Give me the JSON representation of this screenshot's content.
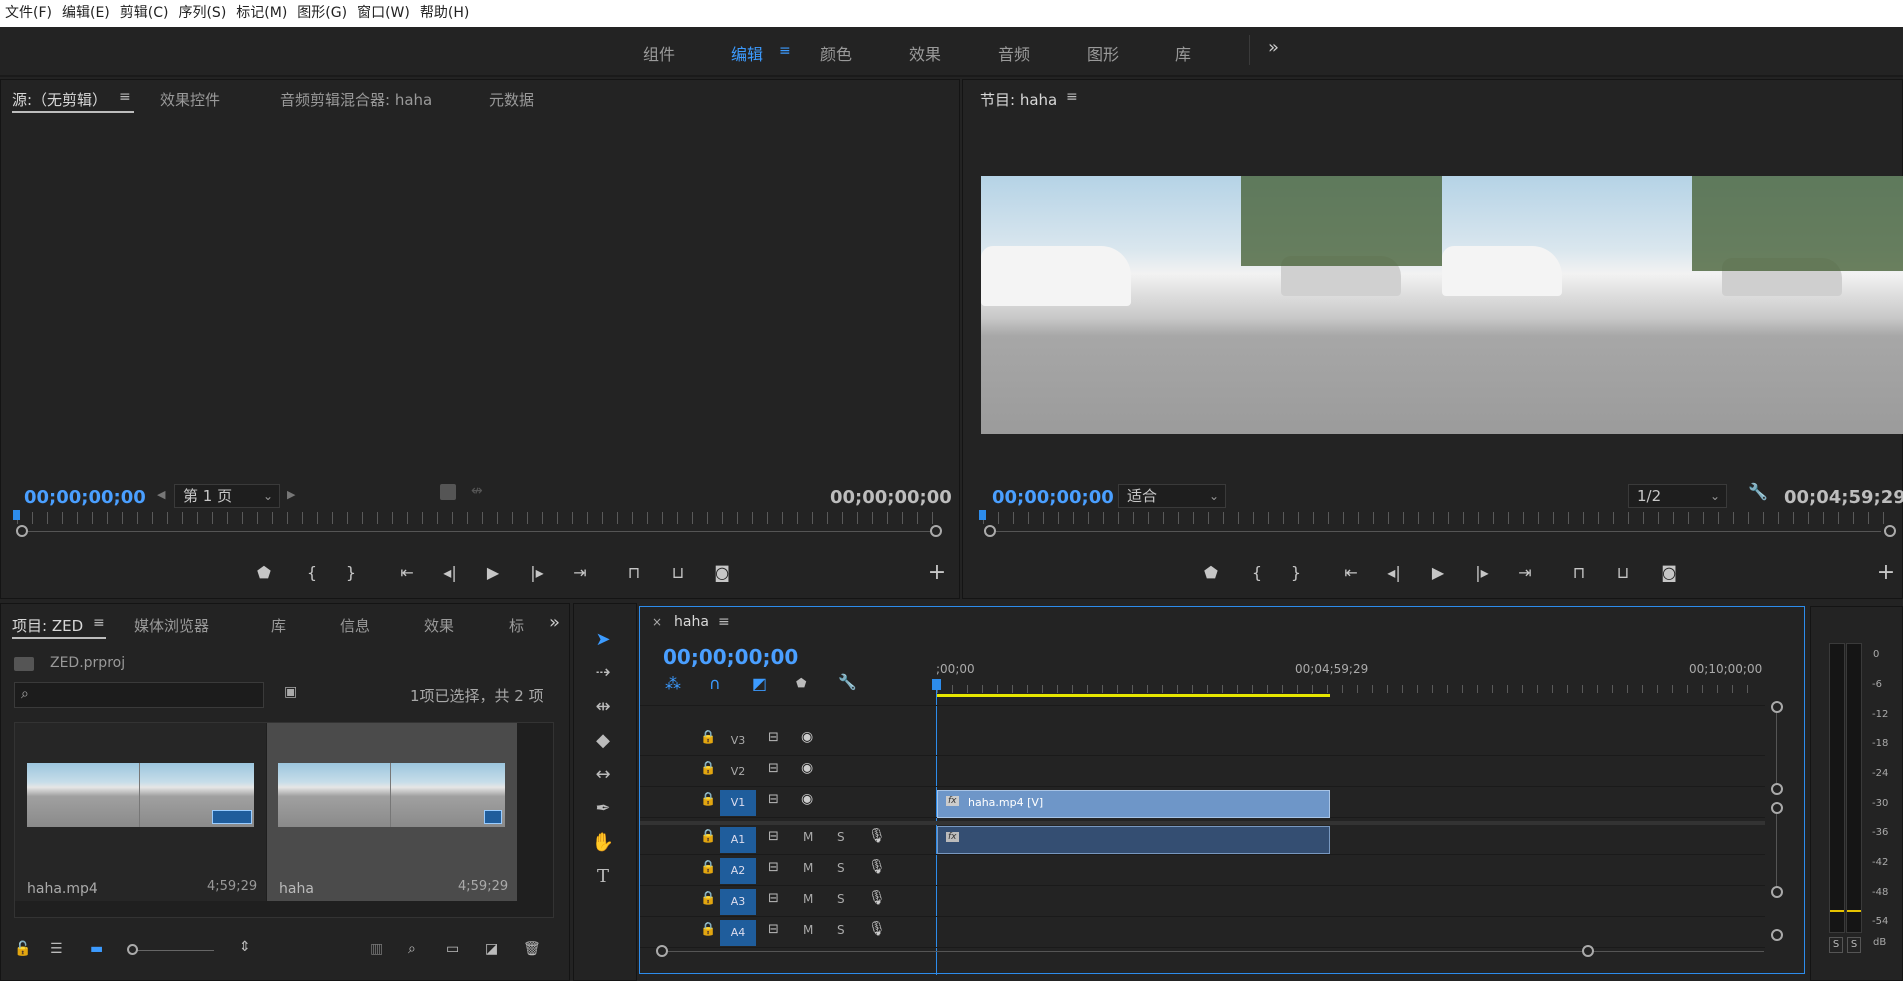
{
  "menubar": {
    "items": [
      "文件(F)",
      "编辑(E)",
      "剪辑(C)",
      "序列(S)",
      "标记(M)",
      "图形(G)",
      "窗口(W)",
      "帮助(H)"
    ]
  },
  "workspaces": {
    "tabs": [
      "组件",
      "编辑",
      "颜色",
      "效果",
      "音频",
      "图形",
      "库"
    ],
    "active": "编辑",
    "more": "»"
  },
  "source": {
    "tabs": [
      "源:（无剪辑）",
      "效果控件",
      "音频剪辑混合器: haha",
      "元数据"
    ],
    "timecode_in": "00;00;00;00",
    "page_select": "第 1 页",
    "timecode_out": "00;00;00;00"
  },
  "program": {
    "title": "节目: haha",
    "timecode_in": "00;00;00;00",
    "fit_select": "适合",
    "res_select": "1/2",
    "timecode_out": "00;04;59;29"
  },
  "project": {
    "tabs": [
      "项目: ZED",
      "媒体浏览器",
      "库",
      "信息",
      "效果",
      "标"
    ],
    "file": "ZED.prproj",
    "selection_info": "1项已选择，共 2 项",
    "search_placeholder": "",
    "items": [
      {
        "name": "haha.mp4",
        "duration": "4;59;29"
      },
      {
        "name": "haha",
        "duration": "4;59;29"
      }
    ]
  },
  "timeline": {
    "tab": "haha",
    "close": "×",
    "timecode": "00;00;00;00",
    "ruler_marks": [
      ";00;00",
      "00;04;59;29",
      "00;10;00;00"
    ],
    "video_tracks": [
      "V3",
      "V2",
      "V1"
    ],
    "audio_tracks": [
      "A1",
      "A2",
      "A3",
      "A4"
    ],
    "clip_label": "haha.mp4 [V]",
    "mute": "M",
    "solo": "S",
    "fx": "fx"
  },
  "meter": {
    "scale": [
      "0",
      "-6",
      "-12",
      "-18",
      "-24",
      "-30",
      "-36",
      "-42",
      "-48",
      "-54",
      "dB"
    ],
    "solo_left": "S",
    "solo_right": "S"
  },
  "colors": {
    "accent": "#3c9bff",
    "playhead": "#2d8ceb",
    "clip_video": "#6e96c8",
    "clip_audio": "#344e72",
    "work_area": "#e6e600"
  }
}
